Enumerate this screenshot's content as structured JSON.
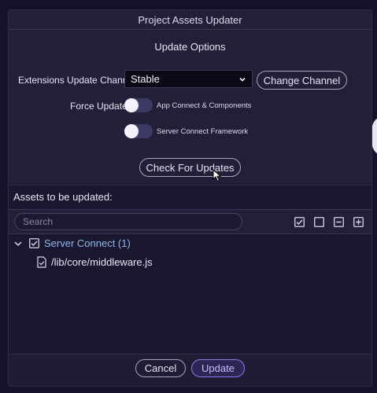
{
  "window": {
    "title": "Project Assets Updater"
  },
  "options": {
    "heading": "Update Options",
    "channel_label": "Extensions Update Channel",
    "channel_value": "Stable",
    "change_channel_label": "Change Channel",
    "force_update_label": "Force Update",
    "toggles": [
      {
        "label": "App Connect & Components",
        "on": false
      },
      {
        "label": "Server Connect Framework",
        "on": false
      }
    ],
    "check_updates_label": "Check For Updates"
  },
  "assets": {
    "heading": "Assets to be updated:",
    "search_placeholder": "Search",
    "toolbar_icons": [
      "check-all-icon",
      "uncheck-all-icon",
      "collapse-all-icon",
      "expand-all-icon"
    ],
    "group": {
      "label": "Server Connect (1)",
      "checked": true,
      "expanded": true
    },
    "files": [
      {
        "path": "/lib/core/middleware.js"
      }
    ]
  },
  "footer": {
    "cancel_label": "Cancel",
    "update_label": "Update"
  },
  "colors": {
    "accent": "#8d7bea",
    "group_text": "#8fb8e8",
    "dialog_bg": "#222039"
  }
}
